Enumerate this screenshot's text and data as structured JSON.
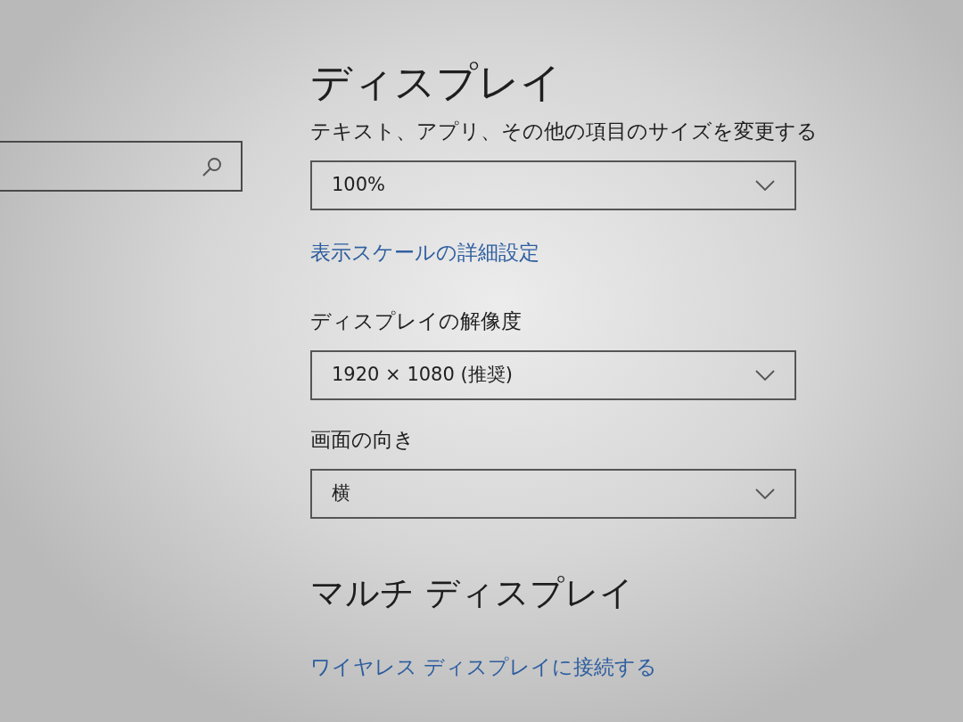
{
  "display": {
    "title": "ディスプレイ",
    "settings": [
      {
        "kind": "dropdown",
        "label": "テキスト、アプリ、その他の項目のサイズを変更する",
        "value": "100%"
      },
      {
        "kind": "link",
        "text": "表示スケールの詳細設定"
      },
      {
        "kind": "dropdown",
        "label": "ディスプレイの解像度",
        "value": "1920 × 1080 (推奨)"
      },
      {
        "kind": "dropdown",
        "label": "画面の向き",
        "value": "横"
      }
    ]
  },
  "multi_display": {
    "title": "マルチ ディスプレイ",
    "link": "ワイヤレス ディスプレイに接続する"
  }
}
